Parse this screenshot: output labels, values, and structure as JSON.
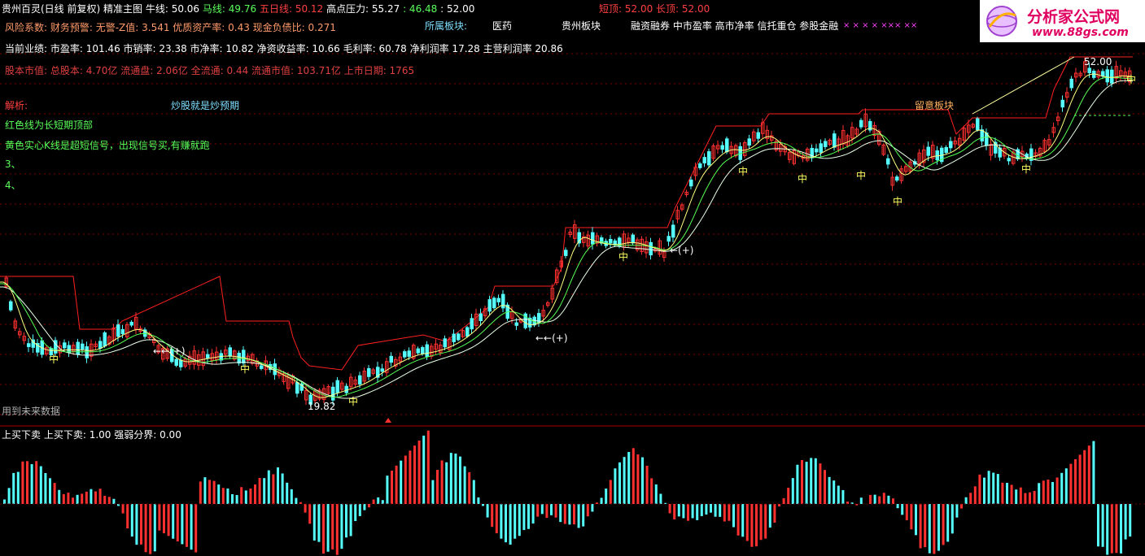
{
  "header": {
    "title": "贵州百灵(日线 前复权) 精准主图",
    "niu_label": "牛线:",
    "niu_value": "50.06",
    "ma_label": "马线:",
    "ma_value": "49.76",
    "wuri_label": "五日线:",
    "wuri_value": "50.12",
    "gaodian_label": "高点压力:",
    "gaodian_value": "55.27",
    "extra_value_1": ": 46.48",
    "extra_value_2": ": 52.00",
    "duanding": "短顶: 52.00",
    "changding": "长顶: 52.00"
  },
  "info_lines": {
    "risk": "风险系数: 财务预警: 无警-Z值: 3.541 优质资产率: 0.43 现金负债比: 0.271",
    "performance": "当前业绩: 市盈率: 101.46 市销率: 23.38 市净率: 10.82 净资收益率: 10.66 毛利率: 60.78 净利润率 17.28 主营利润率 20.86",
    "equity": "股本市值: 总股本: 4.70亿 流通盘: 2.06亿 全流通: 0.44 流通市值: 103.71亿 上市日期: 1765"
  },
  "sectors": {
    "label": "所属板块:",
    "items": [
      "医药",
      "贵州板块",
      "融资融券 中市盈率 高市净率 信托重仓 参股金融"
    ],
    "marks": "× × × × ××× ××"
  },
  "analysis": {
    "title": "解析:",
    "subtitle": "炒股就是炒预期",
    "line1": "红色线为长短期顶部",
    "line2": "黄色实心K线是超短信号，出现信号买,有赚就跑",
    "line3": "3、",
    "line4": "4、"
  },
  "annotations": {
    "watch_sector": "留意板块",
    "low_price": "19.82",
    "high_price": "52.00",
    "future_data": "用到未来数据",
    "arrow_mark_1": "←←(+)",
    "arrow_mark_2": "←←(+)",
    "arrow_mark_3": "←(+)",
    "zhong": "中"
  },
  "sub_panel": {
    "title": "上买下卖",
    "label_1": "上买下卖: 1.00",
    "label_2": "强弱分界: 0.00"
  },
  "logo": {
    "name": "分析家公式网",
    "url": "www.88gs.com"
  },
  "colors": {
    "up": "#ff3030",
    "down": "#55ffff",
    "resistance": "#ff2020",
    "ma_green": "#55ff55",
    "ma_white": "#e8ffe8",
    "grid": "#800000"
  }
}
